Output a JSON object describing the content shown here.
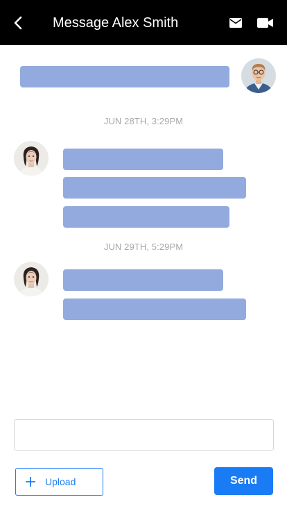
{
  "header": {
    "title": "Message Alex Smith",
    "back_icon": "chevron-left-icon",
    "mail_icon": "envelope-icon",
    "video_icon": "video-camera-icon",
    "background": "#000000",
    "text_color": "#ffffff"
  },
  "conversation": {
    "bubble_color": "#93aade",
    "timestamps": [
      "JUN 28TH, 3:29PM",
      "JUN 29TH, 5:29PM"
    ]
  },
  "composer": {
    "placeholder": "",
    "value": ""
  },
  "actions": {
    "upload_label": "Upload",
    "upload_icon": "plus-icon",
    "send_label": "Send",
    "accent_color": "#1a7cf4"
  }
}
